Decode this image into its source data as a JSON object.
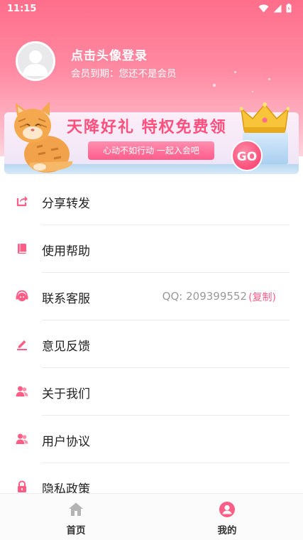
{
  "status_bar": {
    "time": "11:15"
  },
  "profile": {
    "title": "点击头像登录",
    "member_expire": "会员到期：您还不是会员"
  },
  "banner": {
    "title": "天降好礼 特权免费领",
    "subtitle": "心动不如行动 一起入会吧",
    "go_label": "GO"
  },
  "menu": {
    "items": [
      {
        "label": "分享转发",
        "icon": "share-icon"
      },
      {
        "label": "使用帮助",
        "icon": "book-icon"
      },
      {
        "label": "联系客服",
        "icon": "headset-icon"
      },
      {
        "label": "意见反馈",
        "icon": "pencil-icon"
      },
      {
        "label": "关于我们",
        "icon": "users-icon"
      },
      {
        "label": "用户协议",
        "icon": "users-icon"
      },
      {
        "label": "隐私政策",
        "icon": "lock-icon"
      }
    ],
    "contact": {
      "qq": "QQ: 209399552",
      "copy_label": "(复制)"
    }
  },
  "bottom_nav": {
    "items": [
      {
        "label": "首页",
        "icon": "home-icon"
      },
      {
        "label": "我的",
        "icon": "profile-icon"
      }
    ]
  },
  "colors": {
    "accent": "#ff5c86",
    "header_top": "#ff6e8b",
    "text_muted": "#9a9a9a"
  }
}
